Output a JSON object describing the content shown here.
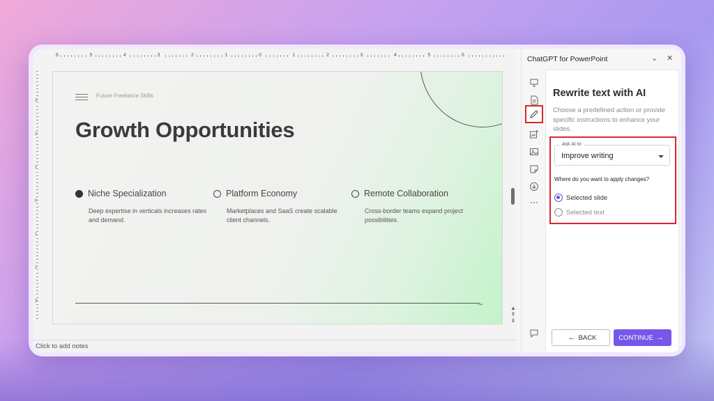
{
  "editor": {
    "ruler_h": [
      "6",
      "5",
      "4",
      "3",
      "2",
      "1",
      "0",
      "1",
      "2",
      "3",
      "4",
      "5",
      "6"
    ],
    "ruler_v": [
      "3",
      "2",
      "1",
      "0",
      "1",
      "2",
      "3"
    ],
    "notes_placeholder": "Click to add notes"
  },
  "slide": {
    "kicker": "Future Freelance Skills",
    "title": "Growth Opportunities",
    "pillars": [
      {
        "label": "Niche Specialization",
        "desc": "Deep expertise in verticals increases rates and demand.",
        "selected": true
      },
      {
        "label": "Platform Economy",
        "desc": "Marketplaces and SaaS create scalable client channels.",
        "selected": false
      },
      {
        "label": "Remote Collaboration",
        "desc": "Cross-border teams expand project possibilities.",
        "selected": false
      }
    ]
  },
  "panel": {
    "title": "ChatGPT for PowerPoint",
    "heading": "Rewrite text with AI",
    "description": "Choose a predefined action or provide specific instructions to enhance your slides.",
    "ask_label": "Ask AI to",
    "ask_value": "Improve writing",
    "apply_question": "Where do you want to apply changes?",
    "options": [
      {
        "label": "Selected slide",
        "checked": true
      },
      {
        "label": "Selected text",
        "checked": false
      }
    ],
    "back_label": "BACK",
    "continue_label": "CONTINUE",
    "rail_icons": [
      "presentation-icon",
      "document-edit-icon",
      "pencil-icon",
      "image-edit-icon",
      "image-icon",
      "sticky-note-icon",
      "download-icon",
      "more-icon"
    ]
  },
  "colors": {
    "accent": "#7558e8",
    "highlight": "#d7262e"
  }
}
